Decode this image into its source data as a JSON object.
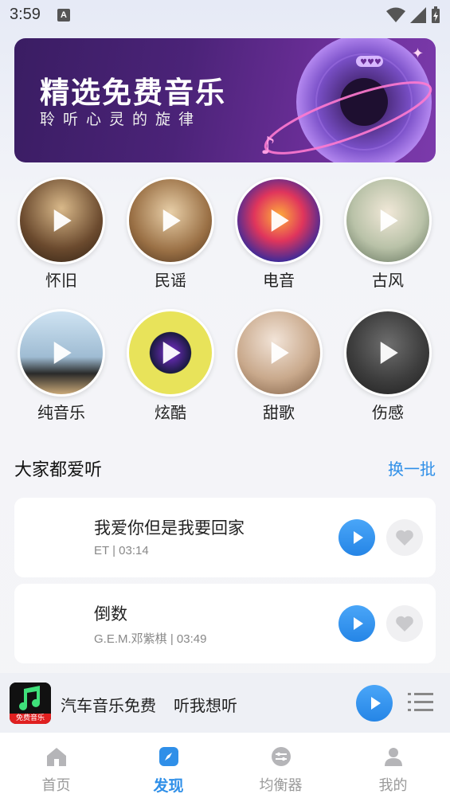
{
  "status_bar": {
    "time": "3:59",
    "notification_icon": "a-icon"
  },
  "banner": {
    "title": "精选免费音乐",
    "subtitle": "聆听心灵的旋律"
  },
  "categories": [
    {
      "label": "怀旧"
    },
    {
      "label": "民谣"
    },
    {
      "label": "电音"
    },
    {
      "label": "古风"
    },
    {
      "label": "纯音乐"
    },
    {
      "label": "炫酷"
    },
    {
      "label": "甜歌"
    },
    {
      "label": "伤感"
    }
  ],
  "popular": {
    "title": "大家都爱听",
    "refresh_label": "换一批",
    "songs": [
      {
        "title": "我爱你但是我要回家",
        "meta": "ET | 03:14"
      },
      {
        "title": "倒数",
        "meta": "G.E.M.邓紫棋 | 03:49"
      }
    ]
  },
  "mini_player": {
    "app_name": "汽车音乐免费",
    "slogan": "听我想听",
    "cover_badge": "免费音乐"
  },
  "tabs": [
    {
      "label": "首页",
      "icon": "home-icon"
    },
    {
      "label": "发现",
      "icon": "compass-icon"
    },
    {
      "label": "均衡器",
      "icon": "equalizer-icon"
    },
    {
      "label": "我的",
      "icon": "user-icon"
    }
  ],
  "colors": {
    "accent": "#2f8fe8",
    "banner_bg": "#4b2378"
  }
}
